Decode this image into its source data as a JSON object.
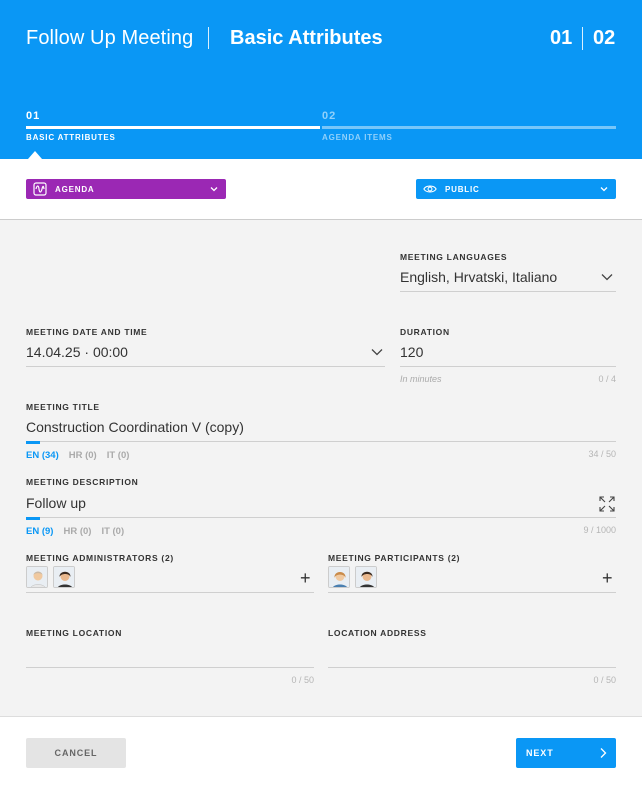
{
  "header": {
    "title": "Follow Up Meeting",
    "subtitle": "Basic Attributes",
    "step_current": "01",
    "step_total": "02"
  },
  "steps": [
    {
      "num": "01",
      "label": "BASIC ATTRIBUTES",
      "active": true
    },
    {
      "num": "02",
      "label": "AGENDA ITEMS",
      "active": false
    }
  ],
  "toolbar": {
    "agenda_label": "AGENDA",
    "agenda_color": "#9b28b4",
    "visibility_label": "PUBLIC",
    "visibility_color": "#0a97f5"
  },
  "form": {
    "languages": {
      "label": "MEETING LANGUAGES",
      "value": "English, Hrvatski, Italiano"
    },
    "datetime": {
      "label": "MEETING DATE AND TIME",
      "value": "14.04.25 · 00:00"
    },
    "duration": {
      "label": "DURATION",
      "value": "120",
      "hint": "In minutes",
      "count": "0 / 4"
    },
    "title": {
      "label": "MEETING TITLE",
      "value": "Construction Coordination V (copy)",
      "count": "34 / 50",
      "langs": [
        "EN (34)",
        "HR (0)",
        "IT (0)"
      ]
    },
    "description": {
      "label": "MEETING DESCRIPTION",
      "value": "Follow up",
      "count": "9 / 1000",
      "langs": [
        "EN (9)",
        "HR (0)",
        "IT (0)"
      ]
    },
    "administrators": {
      "label": "MEETING ADMINISTRATORS (2)",
      "add": "+"
    },
    "participants": {
      "label": "MEETING PARTICIPANTS (2)",
      "add": "+"
    },
    "location": {
      "label": "MEETING LOCATION",
      "value": "",
      "count": "0 / 50"
    },
    "address": {
      "label": "LOCATION ADDRESS",
      "value": "",
      "count": "0 / 50"
    }
  },
  "footer": {
    "cancel_label": "CANCEL",
    "next_label": "NEXT"
  },
  "icons": {
    "agenda": "waveform-icon",
    "visibility": "eye-icon",
    "expand": "expand-icon"
  },
  "colors": {
    "primary": "#0a97f5",
    "agenda": "#9b28b4"
  }
}
